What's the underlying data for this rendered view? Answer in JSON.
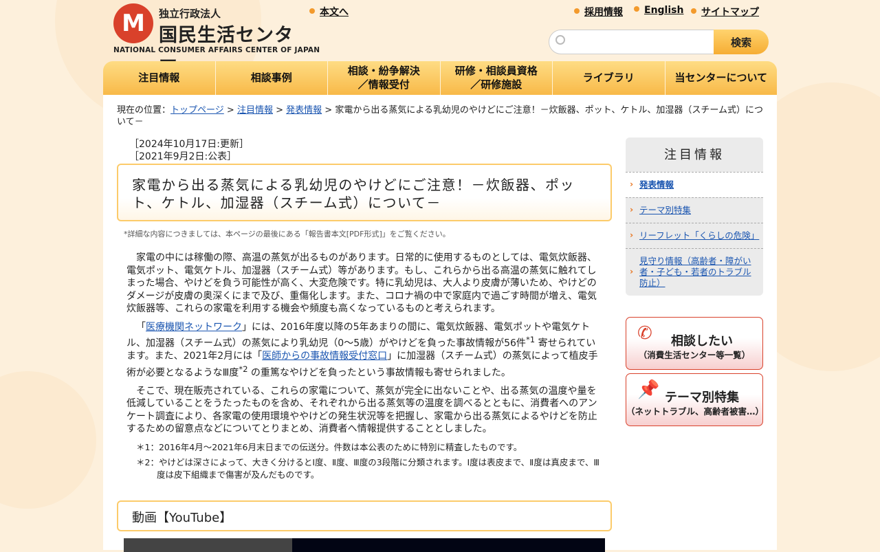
{
  "header": {
    "logo_sub": "独立行政法人",
    "logo_main": "国民生活センター",
    "logo_en": "NATIONAL CONSUMER AFFAIRS CENTER OF JAPAN",
    "skip_link": "本文へ",
    "links": [
      "採用情報",
      "English",
      "サイトマップ"
    ],
    "search_placeholder": "",
    "search_button": "検索"
  },
  "nav": [
    "注目情報",
    "相談事例",
    "相談・紛争解決\n／情報受付",
    "研修・相談員資格\n／研修施設",
    "ライブラリ",
    "当センターについて"
  ],
  "breadcrumb": {
    "prefix": "現在の位置：",
    "items": [
      "トップページ",
      "注目情報",
      "発表情報"
    ],
    "current": "家電から出る蒸気による乳幼児のやけどにご注意！－炊飯器、ポット、ケトル、加湿器（スチーム式）について－"
  },
  "dates": {
    "updated": "［2024年10月17日:更新］",
    "published": "［2021年9月2日:公表］"
  },
  "title": "家電から出る蒸気による乳幼児のやけどにご注意！－炊飯器、ポット、ケトル、加湿器（スチーム式）について－",
  "note": "*詳細な内容につきましては、本ページの最後にある「報告書本文[PDF形式]」をご覧ください。",
  "body": {
    "p1": "家電の中には稼働の際、高温の蒸気が出るものがあります。日常的に使用するものとしては、電気炊飯器、電気ポット、電気ケトル、加湿器（スチーム式）等があります。もし、これらから出る高温の蒸気に触れてしまった場合、やけどを負う可能性が高く、大変危険です。特に乳幼児は、大人より皮膚が薄いため、やけどのダメージが皮膚の奥深くにまで及び、重傷化します。また、コロナ禍の中で家庭内で過ごす時間が増え、電気炊飯器等、これらの家電を利用する機会や頻度も高くなっているものと考えられます。",
    "p2a": "「",
    "p2_link1": "医療機関ネットワーク",
    "p2b": "」には、2016年度以降の5年あまりの間に、電気炊飯器、電気ポットや電気ケトル、加湿器（スチーム式）の蒸気により乳幼児（0～5歳）がやけどを負った事故情報が56件",
    "sup1": "*1",
    "p2c": " 寄せられています。また、2021年2月には「",
    "p2_link2": "医師からの事故情報受付窓口",
    "p2d": "」に加湿器（スチーム式）の蒸気によって植皮手術が必要となるようなⅢ度",
    "sup2": "*2",
    "p2e": " の重篤なやけどを負ったという事故情報も寄せられました。",
    "p3": "そこで、現在販売されている、これらの家電について、蒸気が完全に出ないことや、出る蒸気の温度や量を低減していることをうたったものを含め、それぞれから出る蒸気等の温度を調べるとともに、消費者へのアンケート調査により、各家電の使用環境ややけどの発生状況等を把握し、家電から出る蒸気によるやけどを防止するための留意点などについてとりまとめ、消費者へ情報提供することとしました。",
    "fn1": "＊1：2016年4月～2021年6月末日までの伝送分。件数は本公表のために特別に精査したものです。",
    "fn2": "＊2：やけどは深さによって、大きく分けるとⅠ度、Ⅱ度、Ⅲ度の3段階に分類されます。Ⅰ度は表皮まで、Ⅱ度は真皮まで、Ⅲ度は皮下組織まで傷害が及んだものです。"
  },
  "video_heading": "動画【YouTube】",
  "sidebar": {
    "heading": "注目情報",
    "items": [
      "発表情報",
      "テーマ別特集",
      "リーフレット「くらしの危険」",
      "見守り情報（高齢者・障がい者・子ども・若者のトラブル防止）"
    ]
  },
  "banners": [
    {
      "title": "相談したい",
      "sub": "（消費生活センター等一覧）"
    },
    {
      "title": "テーマ別特集",
      "sub": "（ネットトラブル、高齢者被害…）"
    }
  ]
}
